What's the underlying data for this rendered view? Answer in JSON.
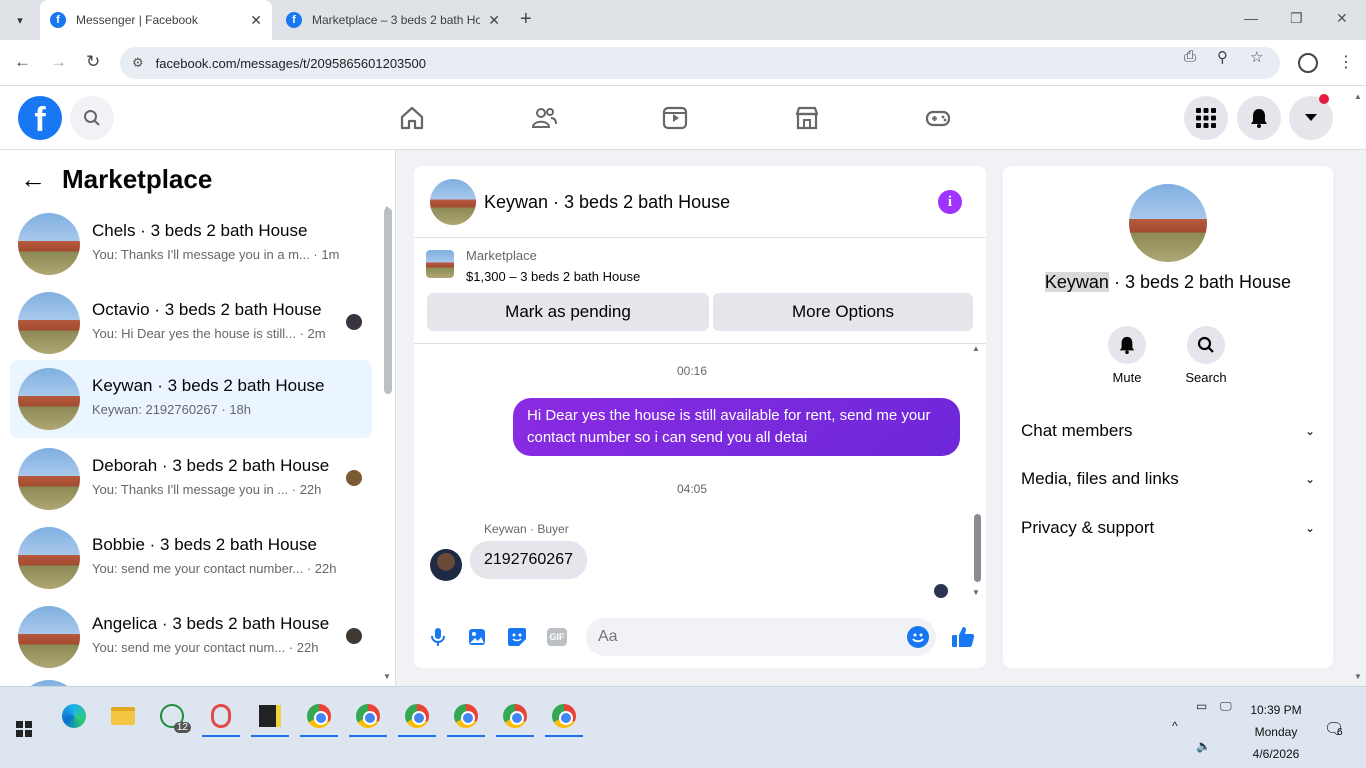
{
  "browser": {
    "tabs": [
      {
        "title": "Messenger | Facebook",
        "favicon": "facebook-icon",
        "active": true
      },
      {
        "title": "Marketplace – 3 beds 2 bath Ho",
        "favicon": "facebook-icon",
        "active": false
      }
    ],
    "url": "facebook.com/messages/t/2095865601203500"
  },
  "fb": {
    "logo": "f",
    "accent": "#1877f2"
  },
  "left": {
    "title": "Marketplace",
    "conversations": [
      {
        "name": "Chels · 3 beds 2 bath House",
        "preview": "You: Thanks I'll message you in a m... · 1m",
        "selected": false
      },
      {
        "name": "Octavio · 3 beds 2 bath House",
        "preview": "You: Hi Dear yes the house is still... · 2m",
        "selected": false
      },
      {
        "name": "Keywan · 3 beds 2 bath House",
        "preview": "Keywan: 2192760267 · 18h",
        "selected": true
      },
      {
        "name": "Deborah · 3 beds 2 bath House",
        "preview": "You: Thanks I'll message you in ... · 22h",
        "selected": false
      },
      {
        "name": "Bobbie · 3 beds 2 bath House",
        "preview": "You: send me your contact number... · 22h",
        "selected": false
      },
      {
        "name": "Angelica · 3 beds 2 bath House",
        "preview": "You: send me your contact num... · 22h",
        "selected": false
      }
    ]
  },
  "chat": {
    "title": "Keywan · 3 beds 2 bath House",
    "listing_source": "Marketplace",
    "listing_price": "$1,300 – 3 beds 2 bath House",
    "mark_pending": "Mark as pending",
    "more_options": "More Options",
    "time1": "00:16",
    "outgoing": "Hi Dear yes the house is still available for rent, send me your contact number so i can send you all detai",
    "time2": "04:05",
    "sender": "Keywan · Buyer",
    "incoming": "2192760267",
    "composer_placeholder": "Aa",
    "outgoing_color": "#7b1fe0"
  },
  "right": {
    "name_first": "Keywan",
    "name_rest": " · 3 beds 2 bath House",
    "mute": "Mute",
    "search": "Search",
    "sections": [
      "Chat members",
      "Media, files and links",
      "Privacy & support"
    ]
  },
  "taskbar": {
    "whatsapp_badge": "12",
    "time": "10:39 PM",
    "day": "Monday",
    "date": "4/6/2026",
    "notif_count": "6"
  }
}
